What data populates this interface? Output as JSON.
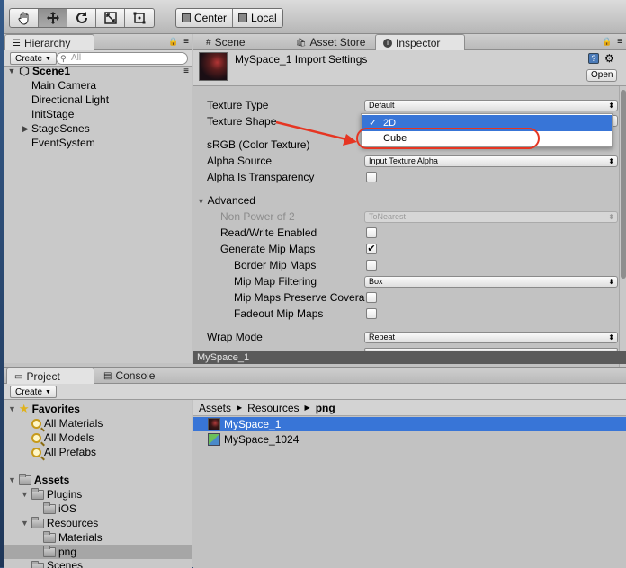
{
  "toolbar": {
    "tools": [
      "hand-icon",
      "move-icon",
      "rotate-icon",
      "scale-icon",
      "rect-icon"
    ],
    "pivot_label": "Center",
    "space_label": "Local"
  },
  "hierarchy": {
    "tab_label": "Hierarchy",
    "create_label": "Create",
    "search_placeholder": "All",
    "scene_name": "Scene1",
    "items": [
      "Main Camera",
      "Directional Light",
      "InitStage",
      "StageScnes",
      "EventSystem"
    ]
  },
  "inspector_tabs": {
    "scene": "Scene",
    "asset_store": "Asset Store",
    "inspector": "Inspector"
  },
  "inspector": {
    "title": "MySpace_1 Import Settings",
    "open_label": "Open",
    "fields": {
      "texture_type": {
        "label": "Texture Type",
        "value": "Default"
      },
      "texture_shape": {
        "label": "Texture Shape"
      },
      "srgb": {
        "label": "sRGB (Color Texture)"
      },
      "alpha_source": {
        "label": "Alpha Source",
        "value": "Input Texture Alpha"
      },
      "alpha_transparency": {
        "label": "Alpha Is Transparency"
      },
      "advanced": {
        "label": "Advanced"
      },
      "non_power_of_2": {
        "label": "Non Power of 2",
        "value": "ToNearest"
      },
      "read_write": {
        "label": "Read/Write Enabled"
      },
      "generate_mip": {
        "label": "Generate Mip Maps",
        "checked": true
      },
      "border_mip": {
        "label": "Border Mip Maps"
      },
      "mip_filtering": {
        "label": "Mip Map Filtering",
        "value": "Box"
      },
      "mip_preserve": {
        "label": "Mip Maps Preserve Covera"
      },
      "fadeout_mip": {
        "label": "Fadeout Mip Maps"
      },
      "wrap_mode": {
        "label": "Wrap Mode",
        "value": "Repeat"
      }
    },
    "shape_dropdown": {
      "options": [
        "2D",
        "Cube"
      ],
      "selected": "2D",
      "check_mark": "✓"
    },
    "preview_label": "MySpace_1"
  },
  "project": {
    "tab_label": "Project",
    "console_label": "Console",
    "create_label": "Create",
    "favorites": {
      "label": "Favorites",
      "items": [
        "All Materials",
        "All Models",
        "All Prefabs"
      ]
    },
    "assets": {
      "label": "Assets",
      "plugins": "Plugins",
      "ios": "iOS",
      "resources": "Resources",
      "materials": "Materials",
      "png": "png",
      "scenes": "Scenes"
    },
    "breadcrumb": [
      "Assets",
      "Resources",
      "png"
    ],
    "breadcrumb_separator": "▶",
    "files": [
      "MySpace_1",
      "MySpace_1024"
    ]
  },
  "colors": {
    "selection": "#3875d7",
    "annotation": "#e63522"
  }
}
